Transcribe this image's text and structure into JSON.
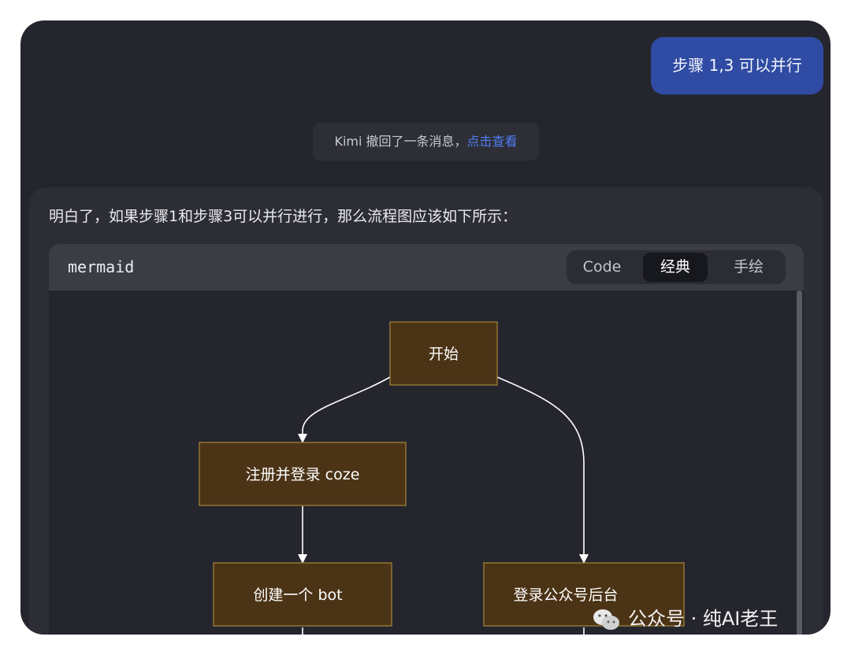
{
  "chat": {
    "user_message": "步骤 1,3 可以并行",
    "notice": {
      "text": "Kimi 撤回了一条消息，",
      "link": "点击查看"
    },
    "assistant_text": "明白了，如果步骤1和步骤3可以并行进行，那么流程图应该如下所示："
  },
  "codeblock": {
    "language": "mermaid",
    "tabs": [
      {
        "label": "Code",
        "active": false
      },
      {
        "label": "经典",
        "active": true
      },
      {
        "label": "手绘",
        "active": false
      }
    ]
  },
  "diagram": {
    "nodes": [
      {
        "id": "start",
        "label": "开始"
      },
      {
        "id": "register",
        "label": "注册并登录 coze"
      },
      {
        "id": "create_bot",
        "label": "创建一个 bot"
      },
      {
        "id": "login_admin",
        "label": "登录公众号后台"
      }
    ],
    "edges": [
      {
        "from": "start",
        "to": "register"
      },
      {
        "from": "start",
        "to": "login_admin"
      },
      {
        "from": "register",
        "to": "create_bot"
      }
    ]
  },
  "watermark": {
    "text": "公众号 · 纯AI老王",
    "icon": "wechat-icon"
  }
}
